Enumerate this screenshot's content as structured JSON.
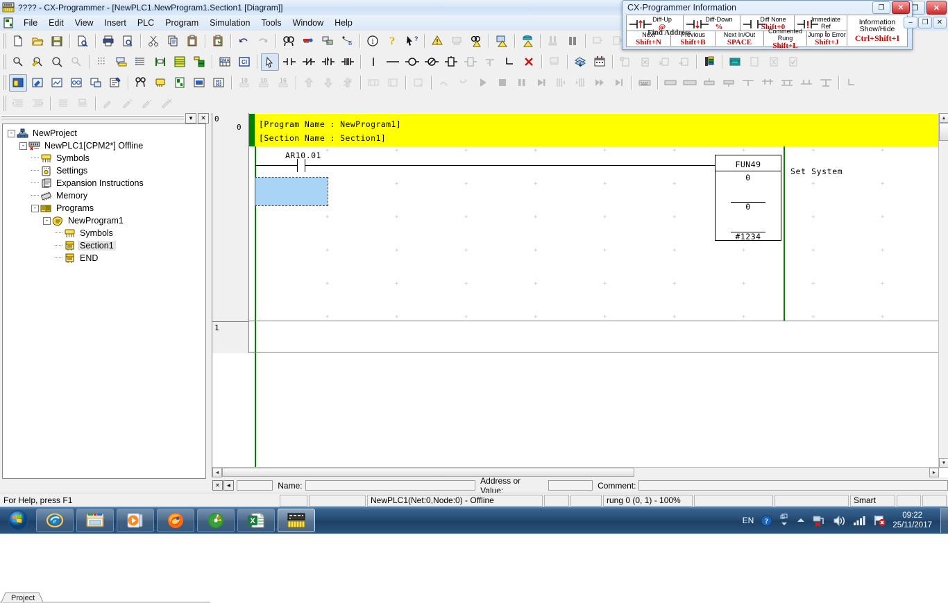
{
  "window": {
    "title": "???? - CX-Programmer - [NewPLC1.NewProgram1.Section1 [Diagram]]",
    "app_icon": "plc-icon",
    "buttons": {
      "minimize": "–",
      "restore": "❐",
      "close": "✕"
    },
    "mdi_buttons": {
      "minimize": "–",
      "restore": "❐",
      "close": "✕"
    }
  },
  "menu": {
    "items": [
      "File",
      "Edit",
      "View",
      "Insert",
      "PLC",
      "Program",
      "Simulation",
      "Tools",
      "Window",
      "Help"
    ]
  },
  "toolbars": {
    "row1": [
      "new-icon",
      "open-icon",
      "save-icon",
      "sep",
      "print-preview-file-icon",
      "sep",
      "print-icon",
      "print-preview-icon",
      "sep",
      "cut-icon",
      "copy-icon",
      "paste-icon",
      "sep",
      "paste-special-icon",
      "sep",
      "undo-icon",
      "redo-icon",
      "sep",
      "find-icon",
      "replace-icon",
      "cross-reference-icon",
      "go-to-icon",
      "sep",
      "info-icon",
      "help-icon",
      "help-pointer-icon",
      "sep",
      "work-online-icon",
      "auto-online-icon",
      "online-find-icon",
      "transfer-to-plc-icon",
      "transfer-from-plc-icon",
      "sep",
      "compare-program-icon",
      "mode-pause-icon",
      "sep",
      "program-mode-icon",
      "debug-mode-icon",
      "monitor-mode-icon",
      "sep",
      "run-mode-icon",
      "differential-monitor-icon",
      "data-trace-icon",
      "sep",
      "plc-memory-icon"
    ],
    "row2": [
      "zoom-icon",
      "zoom-select-icon",
      "zoom-out-icon",
      "zoom-fit-icon",
      "sep",
      "grid-icon",
      "comment-icon",
      "symbol-list-icon",
      "io-comment-icon",
      "memory-table-icon",
      "section-tree-icon",
      "sep",
      "sma-icon",
      "ci-icon",
      "sep",
      "select-mode-icon",
      "contact-na-icon",
      "contact-nc-icon",
      "contact-up-icon",
      "contact-down-icon",
      "vertical-icon",
      "horizontal-icon",
      "coil-icon",
      "coil-inverted-icon",
      "instruction-icon",
      "instruction-alt-icon",
      "link-icon",
      "delete-link-icon",
      "sep",
      "rung-icon",
      "sep",
      "paste-rung-icon",
      "insert-rung-icon",
      "sep",
      "comment-edit-icon",
      "comment-delete-icon",
      "annotate-down-icon",
      "annotate-right-icon",
      "sep",
      "ladder-list-icon",
      "sep",
      "monitor-window-icon",
      "edit-check-icon",
      "delete-check-icon",
      "apply-check-icon"
    ],
    "row3": [
      "project-workspace-icon",
      "address-tool-icon",
      "output-window-icon",
      "watch-window-icon",
      "cross-ref-popup-icon",
      "properties-icon",
      "sep",
      "compile-icon",
      "symbols-view-icon",
      "diagram-view-icon",
      "mnemonic-view-icon",
      "memory-view-icon",
      "sep",
      "decimal-10-icon",
      "signed-10-icon",
      "hex-16-icon",
      "sep",
      "force-on-icon",
      "force-off-icon",
      "force-cancel-icon",
      "sep",
      "set-value-icon",
      "reset-value-icon",
      "sep",
      "clear-icon",
      "sep",
      "differential-up-icon",
      "differential-down-icon",
      "run-icon",
      "stop-icon",
      "pause-icon",
      "step-icon",
      "step-in-icon",
      "step-out-icon",
      "continuous-step-icon",
      "run-to-cursor-icon",
      "sep",
      "keyboard-icon",
      "sep",
      "task1-icon",
      "task2-icon",
      "task3-icon",
      "task4-icon",
      "align-top-icon",
      "align-middle-icon",
      "align-bottom-icon",
      "align-center-icon",
      "distribute-icon",
      "sep",
      "corner-icon"
    ],
    "row4": [
      "indent-icon",
      "outdent-icon",
      "sep",
      "list-icon",
      "note-icon",
      "sep",
      "pen-icon",
      "pen-plus-icon",
      "pen-minus-icon",
      "pen-delete-icon"
    ]
  },
  "project_tree": {
    "caption_buttons": {
      "dropdown": "▾",
      "close": "✕"
    },
    "nodes": [
      {
        "label": "NewProject",
        "icon": "project-icon",
        "indent": 0,
        "expander": "-",
        "selected": false
      },
      {
        "label": "NewPLC1[CPM2*] Offline",
        "icon": "plc-offline-icon",
        "indent": 1,
        "expander": "-",
        "selected": false
      },
      {
        "label": "Symbols",
        "icon": "symbols-icon",
        "indent": 2,
        "expander": "",
        "selected": false
      },
      {
        "label": "Settings",
        "icon": "settings-icon",
        "indent": 2,
        "expander": "",
        "selected": false
      },
      {
        "label": "Expansion Instructions",
        "icon": "expansion-instructions-icon",
        "indent": 2,
        "expander": "",
        "selected": false
      },
      {
        "label": "Memory",
        "icon": "memory-icon",
        "indent": 2,
        "expander": "",
        "selected": false
      },
      {
        "label": "Programs",
        "icon": "programs-icon",
        "indent": 2,
        "expander": "-",
        "selected": false
      },
      {
        "label": "NewProgram1",
        "icon": "program-icon",
        "indent": 3,
        "expander": "-",
        "selected": false
      },
      {
        "label": "Symbols",
        "icon": "symbols-icon",
        "indent": 4,
        "expander": "",
        "selected": false
      },
      {
        "label": "Section1",
        "icon": "section-icon",
        "indent": 4,
        "expander": "",
        "selected": true
      },
      {
        "label": "END",
        "icon": "section-icon",
        "indent": 4,
        "expander": "",
        "selected": false
      }
    ],
    "tab_label": "Project"
  },
  "diagram": {
    "rung_numbers": [
      "0",
      "1"
    ],
    "rung_step": "0",
    "comments": [
      "[Program Name : NewProgram1]",
      "[Section Name : Section1]"
    ],
    "contact": {
      "address": "AR10.01"
    },
    "function_block": {
      "name": "FUN49",
      "operands": [
        "0",
        "0",
        "#1234"
      ],
      "comment": "Set System"
    }
  },
  "input_bar": {
    "close_btn": "✕",
    "back_btn": "◄",
    "name_label": "Name:",
    "name_value": "",
    "address_label": "Address or Value:",
    "address_value": "",
    "comment_label": "Comment:",
    "comment_value": ""
  },
  "status_bar": {
    "help_text": "For Help, press F1",
    "connection": "NewPLC1(Net:0,Node:0) - Offline",
    "rung_info": "rung 0 (0, 1)  - 100%",
    "mode": "Smart",
    "extra": [
      "",
      "",
      "",
      ""
    ]
  },
  "info_window": {
    "title": "CX-Programmer Information",
    "buttons": {
      "restore": "❐",
      "close": "✕"
    },
    "group_label": "Find Address",
    "row1": [
      {
        "label": "Diff-Up",
        "key": "@",
        "icon": "diff-up-contact-icon"
      },
      {
        "label": "Diff-Down",
        "key": "%",
        "icon": "diff-down-contact-icon"
      },
      {
        "label": "Diff None",
        "key": "Shift+0",
        "icon": "diff-none-contact-icon"
      },
      {
        "label": "Immediate Ref",
        "key": "!",
        "icon": "immediate-ref-contact-icon"
      }
    ],
    "row2": [
      {
        "label": "Next",
        "key": "Shift+N"
      },
      {
        "label": "Previous",
        "key": "Shift+B"
      },
      {
        "label": "Next In/Out",
        "key": "SPACE"
      },
      {
        "label": "Commented Rung",
        "key": "Shift+L"
      },
      {
        "label": "Jump to Error",
        "key": "Shift+J"
      }
    ],
    "show_hide": {
      "label1": "Information",
      "label2": "Show/Hide",
      "key": "Ctrl+Shift+I"
    }
  },
  "taskbar": {
    "start": "start-orb-icon",
    "items": [
      "internet-explorer-icon",
      "windows-explorer-icon",
      "media-player-icon",
      "firefox-icon",
      "nero-icon",
      "excel-icon",
      "cx-programmer-icon"
    ],
    "tray": {
      "language": "EN",
      "help": "help-tray-icon",
      "show_hidden": "show-hidden-icons-icon",
      "network": "network-error-icon",
      "volume": "volume-icon",
      "signal": "signal-icon",
      "flag": "action-center-flag-icon",
      "time": "09:22",
      "date": "25/11/2017"
    }
  },
  "colors": {
    "comment_yellow": "#ffff00",
    "rail_green": "#008000",
    "selection_blue": "#aad4f5",
    "key_red": "#d00000",
    "taskbar_blue": "#2b5480"
  }
}
